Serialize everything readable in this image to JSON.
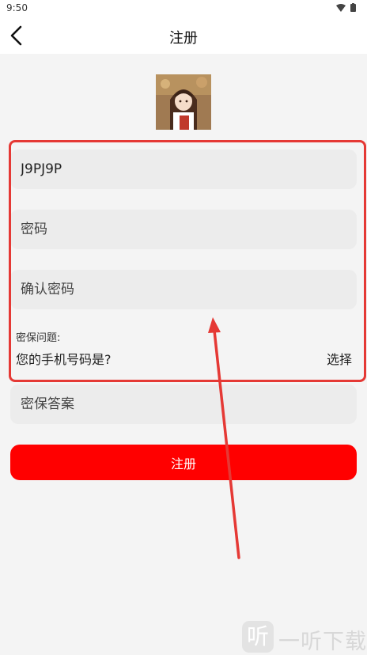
{
  "status_bar": {
    "time": "9:50",
    "icons": [
      "wifi-icon",
      "battery-icon"
    ]
  },
  "header": {
    "title": "注册",
    "back_icon": "chevron-left-icon"
  },
  "form": {
    "account_value": "J9PJ9P",
    "password_placeholder": "密码",
    "confirm_password_placeholder": "确认密码",
    "security_question_label": "密保问题:",
    "security_question_value": "您的手机号码是?",
    "choose_label": "选择",
    "security_answer_placeholder": "密保答案",
    "submit_label": "注册"
  },
  "watermark": {
    "logo_char": "听",
    "text": "一听下载"
  },
  "colors": {
    "primary": "#ff0000",
    "annotation": "#e53935",
    "background": "#f4f4f4",
    "field_bg": "#ececec"
  }
}
